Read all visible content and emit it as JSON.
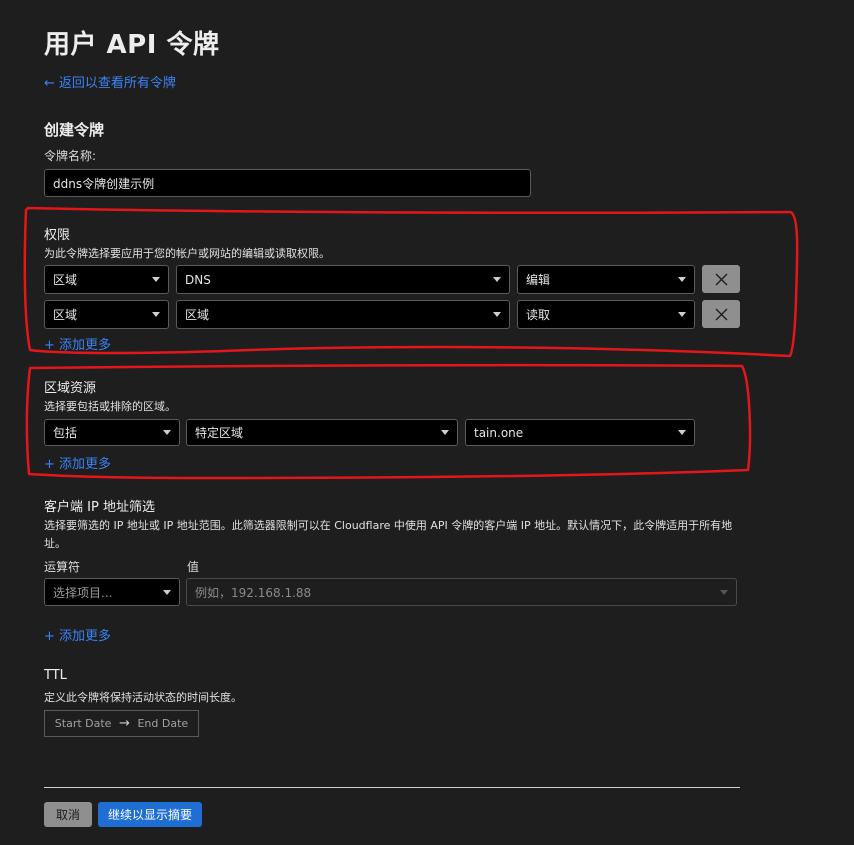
{
  "page": {
    "title": "用户 API 令牌",
    "back_link_arrow": "←",
    "back_link": "返回以查看所有令牌",
    "section_title": "创建令牌"
  },
  "token_name": {
    "label": "令牌名称:",
    "value": "ddns令牌创建示例"
  },
  "permissions": {
    "title": "权限",
    "description": "为此令牌选择要应用于您的帐户或网站的编辑或读取权限。",
    "rows": [
      {
        "scope": "区域",
        "resource": "DNS",
        "access": "编辑"
      },
      {
        "scope": "区域",
        "resource": "区域",
        "access": "读取"
      }
    ],
    "add_more": "+ 添加更多"
  },
  "zone_resources": {
    "title": "区域资源",
    "description": "选择要包括或排除的区域。",
    "include": "包括",
    "type": "特定区域",
    "zone": "tain.one",
    "add_more": "+ 添加更多"
  },
  "ip_filter": {
    "title": "客户端 IP 地址筛选",
    "description": "选择要筛选的 IP 地址或 IP 地址范围。此筛选器限制可以在 Cloudflare 中使用 API 令牌的客户端 IP 地址。默认情况下，此令牌适用于所有地址。",
    "operator_label": "运算符",
    "value_label": "值",
    "operator_placeholder": "选择项目...",
    "value_placeholder": "例如，192.168.1.88",
    "add_more": "+ 添加更多"
  },
  "ttl": {
    "title": "TTL",
    "description": "定义此令牌将保持活动状态的时间长度。",
    "start_placeholder": "Start Date",
    "arrow": "→",
    "end_placeholder": "End Date"
  },
  "actions": {
    "cancel": "取消",
    "continue": "继续以显示摘要"
  },
  "colors": {
    "background": "#1e1e1e",
    "link": "#3b82f6",
    "primary_button": "#1f6ed4",
    "annotation": "#e3161b"
  }
}
